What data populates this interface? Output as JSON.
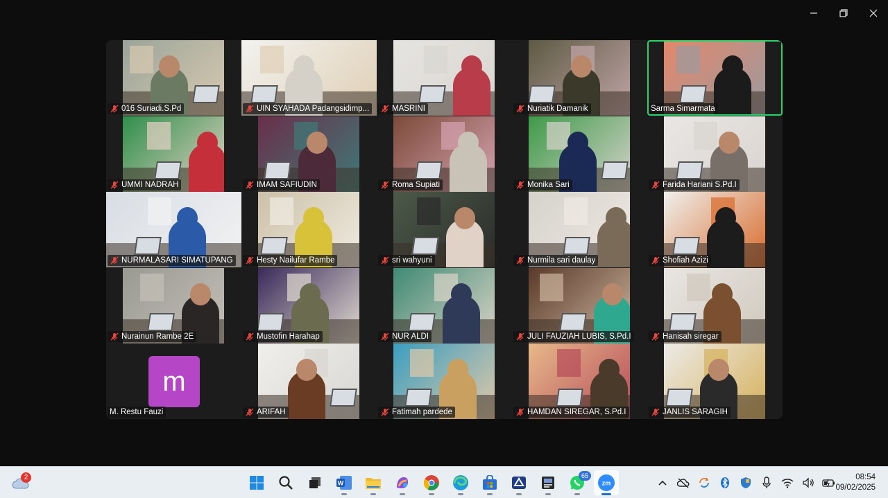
{
  "window": {
    "controls": [
      "minimize",
      "restore",
      "close"
    ]
  },
  "gallery": {
    "participants": [
      {
        "name": "016 Suriadi.S.Pd",
        "muted": true
      },
      {
        "name": "UIN SYAHADA Padangsidimp...",
        "muted": true
      },
      {
        "name": "MASRINI",
        "muted": true
      },
      {
        "name": "Nuriatik Damanik",
        "muted": true
      },
      {
        "name": "Sarma Simarmata",
        "muted": false,
        "active_speaker": true
      },
      {
        "name": "UMMI NADRAH",
        "muted": true
      },
      {
        "name": "IMAM SAFIUDIN",
        "muted": true
      },
      {
        "name": "Roma Supiati",
        "muted": true
      },
      {
        "name": "Monika Sari",
        "muted": true
      },
      {
        "name": "Farida Hariani S.Pd.I",
        "muted": true
      },
      {
        "name": "NURMALASARI SIMATUPANG",
        "muted": true
      },
      {
        "name": "Hesty Nailufar Rambe",
        "muted": true
      },
      {
        "name": "sri wahyuni",
        "muted": true
      },
      {
        "name": "Nurmila sari daulay",
        "muted": true
      },
      {
        "name": "Shofiah Azizi",
        "muted": true
      },
      {
        "name": "Nurainun Rambe 2E",
        "muted": true
      },
      {
        "name": "Mustofin Harahap",
        "muted": true
      },
      {
        "name": "NUR ALDI",
        "muted": true
      },
      {
        "name": "JULI FAUZIAH LUBIS, S.Pd.I",
        "muted": true
      },
      {
        "name": "Hanisah siregar",
        "muted": true
      },
      {
        "name": "M. Restu Fauzi",
        "muted": false,
        "avatar_letter": "m",
        "avatar_color": "#b547c7"
      },
      {
        "name": "ARIFAH",
        "muted": true
      },
      {
        "name": "Fatimah pardede",
        "muted": true
      },
      {
        "name": "HAMDAN SIREGAR, S.Pd.I",
        "muted": true
      },
      {
        "name": "JANLIS SARAGIH",
        "muted": true
      }
    ],
    "active_speaker_color": "#2ad46a",
    "muted_icon_color": "#e8453c"
  },
  "taskbar": {
    "notification_count": "2",
    "apps": [
      {
        "name": "windows-start",
        "icon": "windows-logo"
      },
      {
        "name": "search",
        "icon": "search-icon"
      },
      {
        "name": "task-view",
        "icon": "task-view-icon"
      },
      {
        "name": "word",
        "icon": "word-icon"
      },
      {
        "name": "file-explorer",
        "icon": "folder-icon"
      },
      {
        "name": "copilot",
        "icon": "copilot-icon"
      },
      {
        "name": "chrome",
        "icon": "chrome-icon"
      },
      {
        "name": "edge",
        "icon": "edge-icon"
      },
      {
        "name": "store",
        "icon": "store-icon"
      },
      {
        "name": "app-unknown",
        "icon": "app-icon"
      },
      {
        "name": "id-app",
        "icon": "id-card-icon"
      },
      {
        "name": "whatsapp",
        "icon": "whatsapp-icon",
        "badge": "65"
      },
      {
        "name": "zoom",
        "icon": "zoom-icon",
        "active": true
      }
    ],
    "tray": [
      "chevron-up-icon",
      "cloud-off-icon",
      "sync-icon",
      "bluetooth-icon",
      "shield-icon",
      "microphone-icon",
      "wifi-icon",
      "volume-icon",
      "battery-icon"
    ],
    "time": "08:54",
    "date": "09/02/2025"
  }
}
